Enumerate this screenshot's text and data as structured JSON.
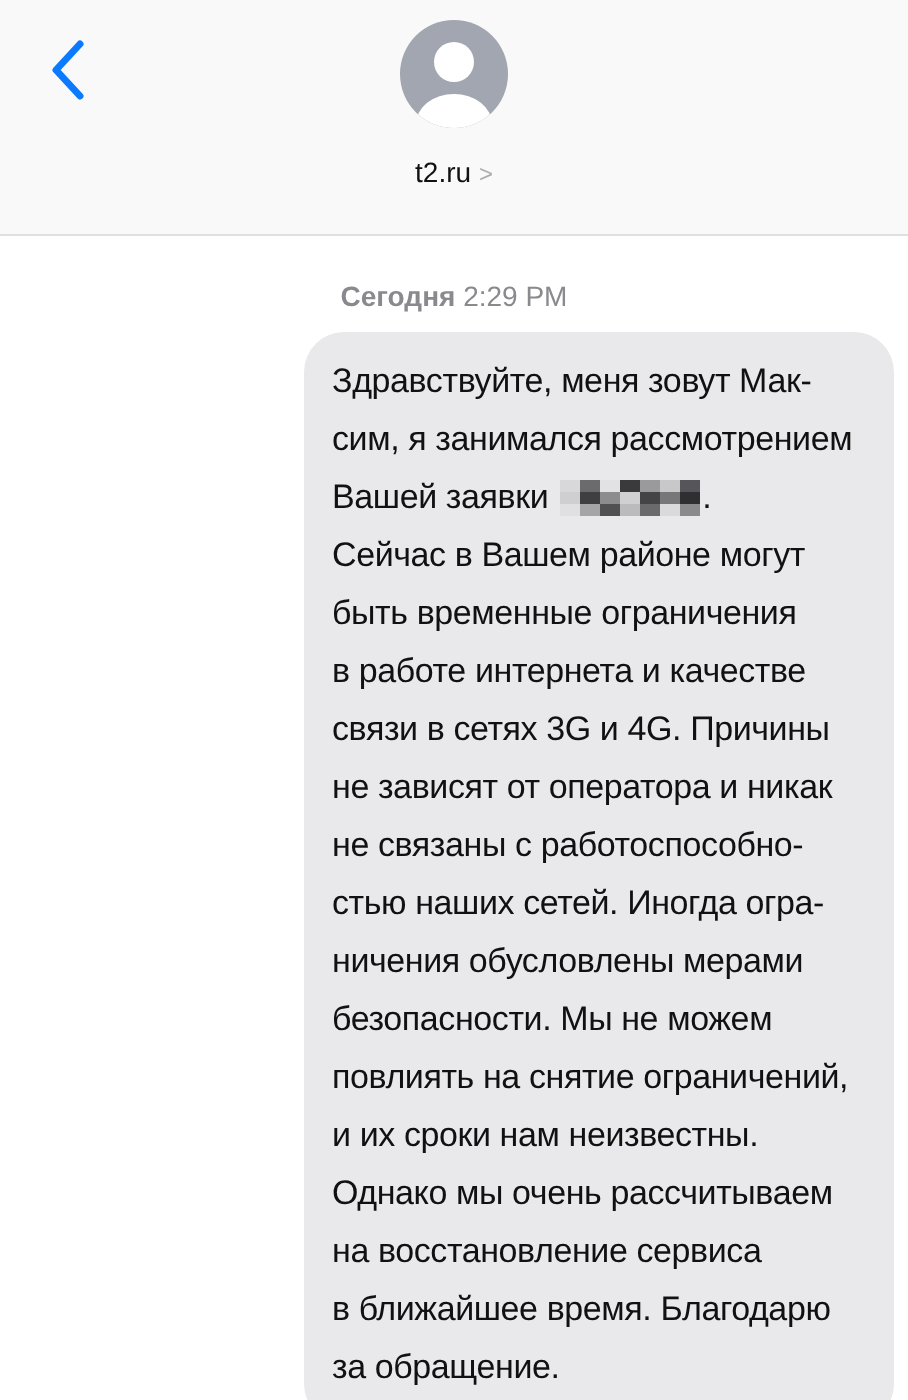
{
  "header": {
    "sender": "t2.ru",
    "chevron": ">"
  },
  "timestamp": {
    "day": "Сегодня",
    "time": "2:29 PM"
  },
  "message": {
    "lines_before": "Здравствуйте, меня зовут Мак-\nсим, я занимался рассмотрением",
    "redacted_line_start": "Вашей заявки",
    "redacted_line_end": ".",
    "lines_after": "Сейчас в Вашем районе могут\nбыть временные ограничения\nв работе интернета и качестве\nсвязи в сетях 3G и 4G. Причины\nне зависят от оператора и никак\nне связаны с работоспособно-\nстью наших сетей. Иногда огра-\nничения обусловлены мерами\nбезопасности. Мы не можем\nповлиять на снятие ограничений,\nи их сроки нам неизвестны.\nОднако мы очень рассчитываем\nна восстановление сервиса\nв ближайшее время. Благодарю\nза обращение."
  }
}
